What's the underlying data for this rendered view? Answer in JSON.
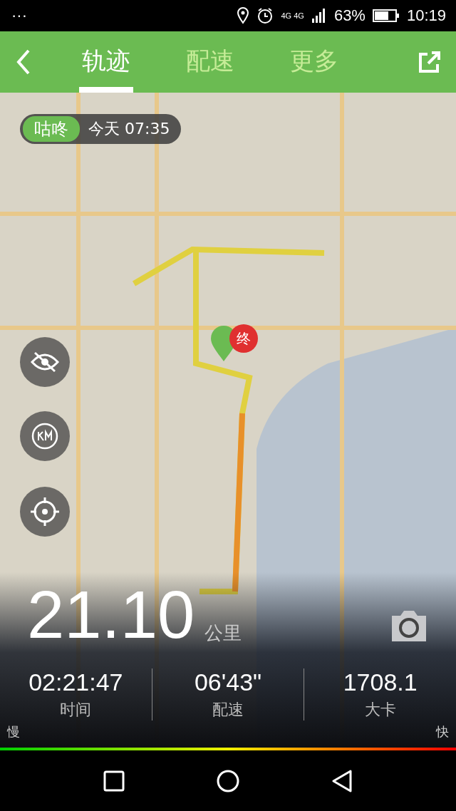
{
  "status_bar": {
    "menu": "···",
    "network": "4G 4G",
    "battery": "63%",
    "time": "10:19"
  },
  "tabs": [
    {
      "label": "轨迹",
      "selected": true
    },
    {
      "label": "配速",
      "selected": false
    },
    {
      "label": "更多",
      "selected": false
    }
  ],
  "badge": {
    "tag": "咕咚",
    "time": "今天 07:35"
  },
  "distance": {
    "value": "21.10",
    "unit": "公里"
  },
  "stats": [
    {
      "value": "02:21:47",
      "label": "时间"
    },
    {
      "value": "06'43\"",
      "label": "配速"
    },
    {
      "value": "1708.1",
      "label": "大卡"
    }
  ],
  "legend": {
    "slow": "慢",
    "fast": "快"
  },
  "end_marker": "终"
}
